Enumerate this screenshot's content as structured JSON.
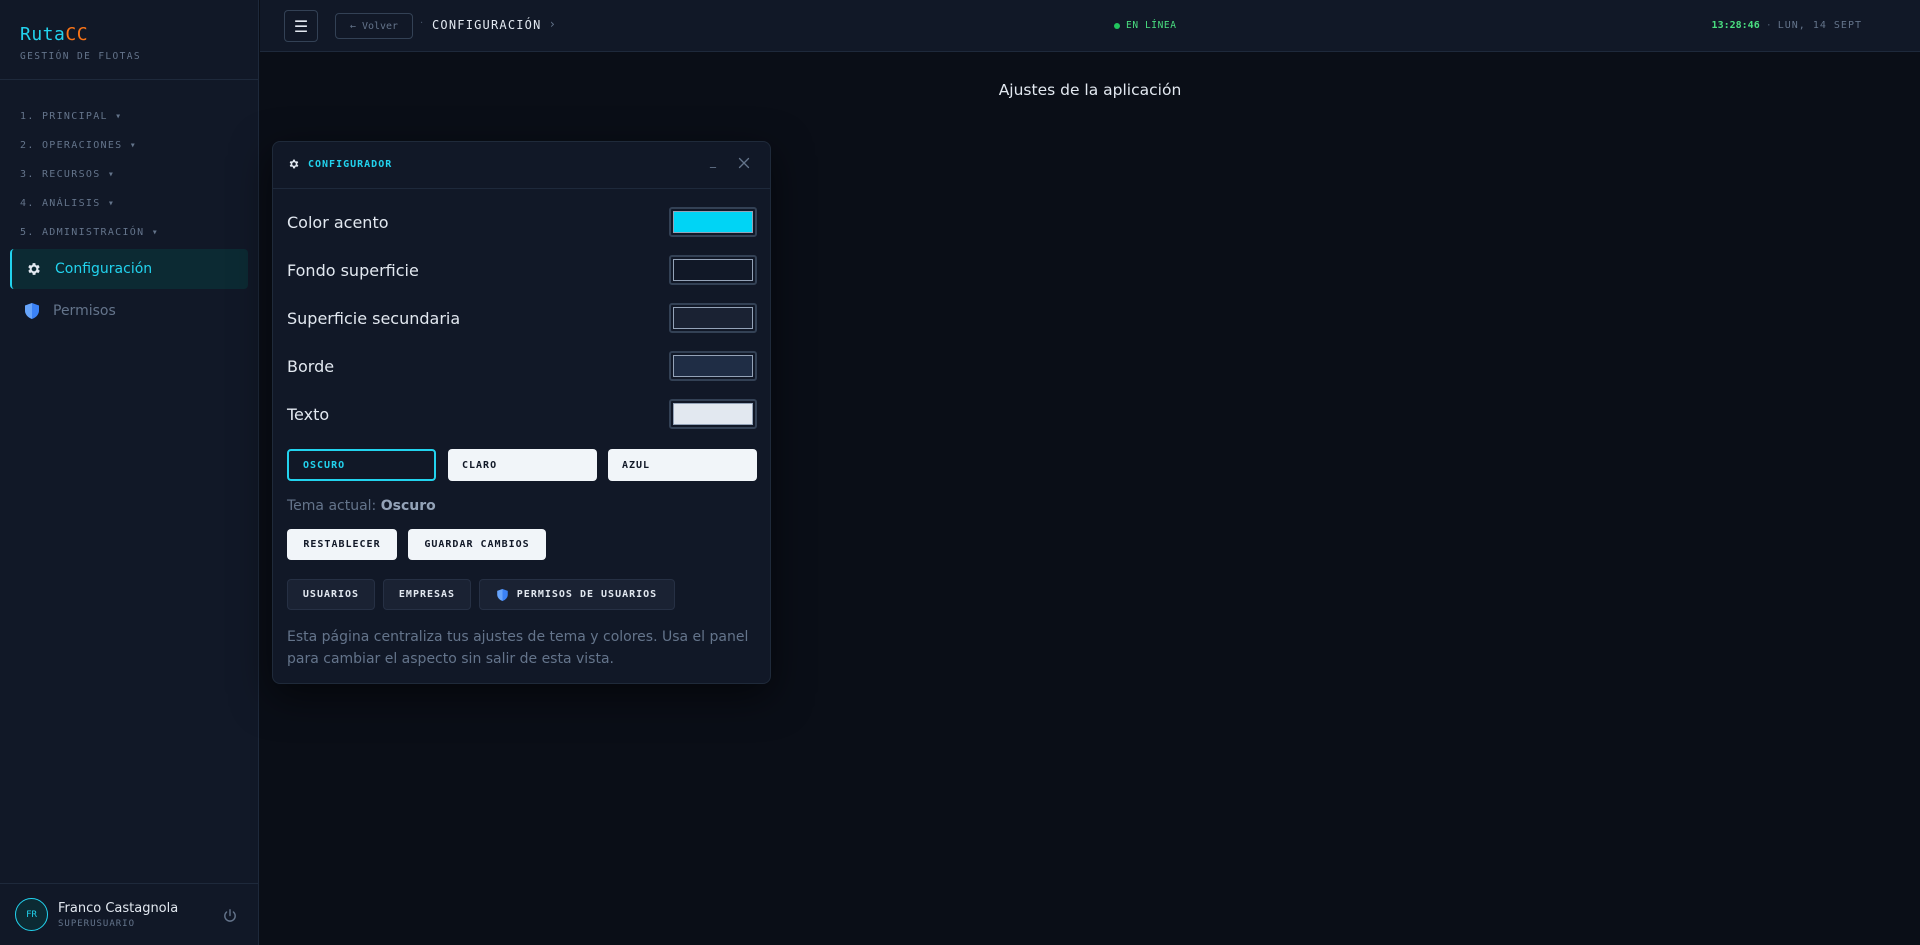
{
  "brand": {
    "name_a": "Ruta",
    "name_b": "CC",
    "subtitle": "GESTIÓN DE FLOTAS"
  },
  "sidebar": {
    "groups": [
      {
        "label": "1. PRINCIPAL ▾"
      },
      {
        "label": "2. OPERACIONES ▾"
      },
      {
        "label": "3. RECURSOS ▾"
      },
      {
        "label": "4. ANÁLISIS ▾"
      },
      {
        "label": "5. ADMINISTRACIÓN ▾"
      }
    ],
    "items": [
      {
        "label": "Configuración",
        "icon": "gear-icon",
        "active": true
      },
      {
        "label": "Permisos",
        "icon": "shield-icon",
        "active": false
      }
    ]
  },
  "user": {
    "initials": "FR",
    "name": "Franco Castagnola",
    "role": "SUPERUSUARIO"
  },
  "topbar": {
    "back_label": "← Volver",
    "breadcrumb_sep": "·",
    "breadcrumb": "CONFIGURACIÓN",
    "breadcrumb_chevron": "›",
    "status": "EN LÍNEA",
    "time": "13:28:46",
    "clock_sep": "·",
    "date": "LUN, 14 SEPT"
  },
  "page": {
    "title": "Ajustes de la aplicación"
  },
  "panel": {
    "title": "CONFIGURADOR",
    "minimize": "_",
    "colors": [
      {
        "label": "Color acento",
        "value": "#00d4f5"
      },
      {
        "label": "Fondo superficie",
        "value": "#111827"
      },
      {
        "label": "Superficie secundaria",
        "value": "#1a2233"
      },
      {
        "label": "Borde",
        "value": "#1f2d45"
      },
      {
        "label": "Texto",
        "value": "#e2e8f0"
      }
    ],
    "themes": [
      {
        "label": "OSCURO",
        "active": true
      },
      {
        "label": "CLARO",
        "active": false
      },
      {
        "label": "AZUL",
        "active": false
      }
    ],
    "current_prefix": "Tema actual:",
    "current_value": "Oscuro",
    "reset_label": "RESTABLECER",
    "save_label": "GUARDAR CAMBIOS",
    "links": [
      {
        "label": "USUARIOS"
      },
      {
        "label": "EMPRESAS"
      },
      {
        "label": "PERMISOS DE USUARIOS",
        "icon": "shield-icon"
      }
    ],
    "note": "Esta página centraliza tus ajustes de tema y colores. Usa el panel para cambiar el aspecto sin salir de esta vista."
  },
  "colors": {
    "accent": "#22d3ee",
    "brand_secondary": "#f97316",
    "online": "#22c55e",
    "background": "#0a0e17"
  }
}
